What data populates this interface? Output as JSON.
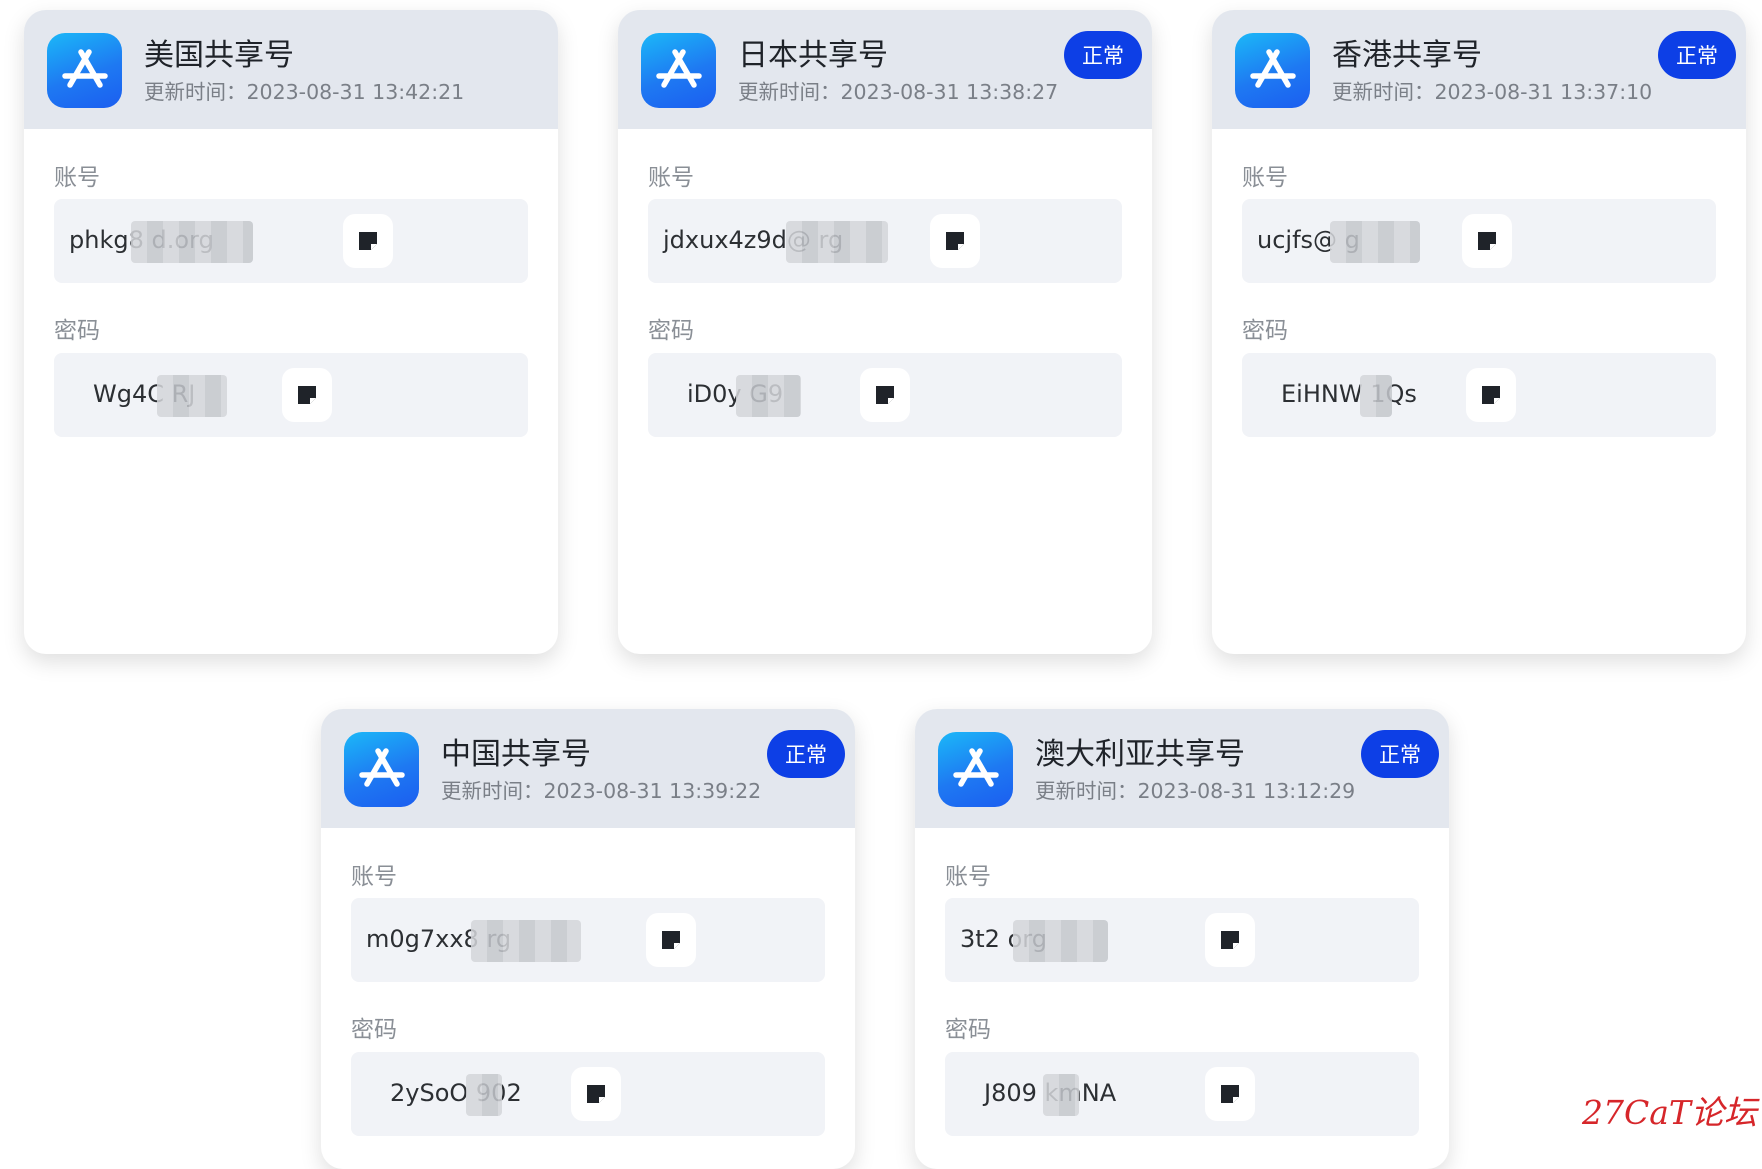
{
  "labels": {
    "account": "账号",
    "password": "密码"
  },
  "colors": {
    "badge": "#0d3fe6",
    "header": "#e3e7ee",
    "watermark": "#d6262a"
  },
  "icons": {
    "app": "app-store-icon",
    "copy": "copy-note-icon"
  },
  "cards": [
    {
      "title": "美国共享号",
      "update_time": "更新时间：2023-08-31 13:42:21",
      "status": "",
      "account": "phkg8         d.org",
      "password": "Wg4C      RJ"
    },
    {
      "title": "日本共享号",
      "update_time": "更新时间：2023-08-31 13:38:27",
      "status": "正常",
      "account": "jdxux4z9d@        rg",
      "password": "iD0y     G9"
    },
    {
      "title": "香港共享号",
      "update_time": "更新时间：2023-08-31 13:37:10",
      "status": "正常",
      "account": "ucjfs@         g",
      "password": "EiHNW   1Qs"
    },
    {
      "title": "中国共享号",
      "update_time": "更新时间：2023-08-31 13:39:22",
      "status": "正常",
      "account": "m0g7xx8          rg",
      "password": "2ySoO    902"
    },
    {
      "title": "澳大利亚共享号",
      "update_time": "更新时间：2023-08-31 13:12:29",
      "status": "正常",
      "account": "3t2          org",
      "password": "J809    kmNA"
    }
  ],
  "watermark": "27CaT论坛"
}
